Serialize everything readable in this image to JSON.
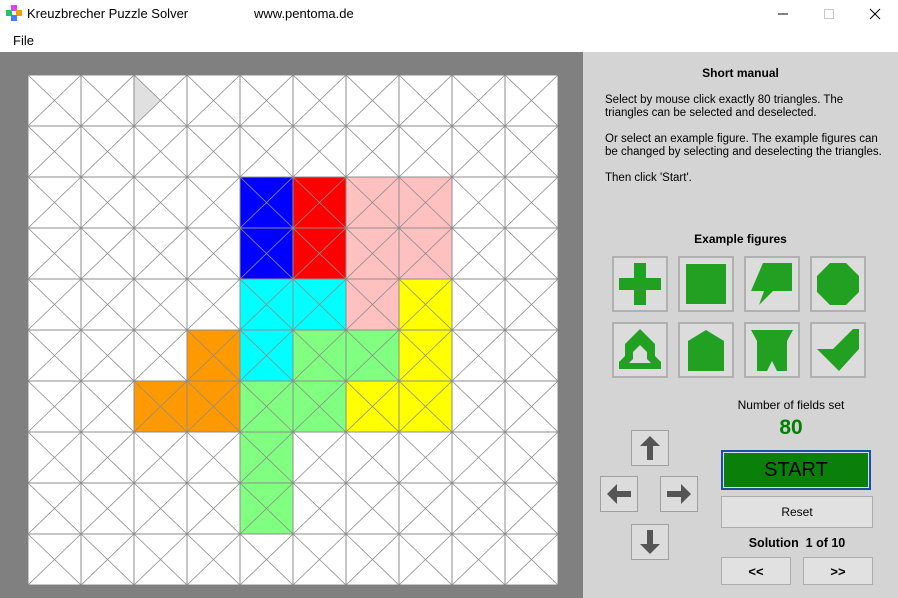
{
  "window": {
    "title": "Kreuzbrecher Puzzle Solver",
    "url": "www.pentoma.de",
    "controls": [
      "minimize",
      "maximize",
      "close"
    ]
  },
  "menu": {
    "items": [
      "File"
    ]
  },
  "manual": {
    "title": "Short manual",
    "paragraphs": [
      "Select by mouse click exactly 80 triangles. The triangles can be selected and deselected.",
      "Or select an example figure. The example figures can be changed by selecting and deselecting the triangles.",
      "Then click 'Start'."
    ]
  },
  "examples": {
    "title": "Example figures",
    "items": [
      "plus-figure",
      "square-figure",
      "arrow-figure",
      "octagon-figure",
      "arch-figure",
      "house-figure",
      "pillar-figure",
      "check-figure"
    ]
  },
  "fields": {
    "label": "Number of fields set",
    "value": "80"
  },
  "buttons": {
    "start": "START",
    "reset": "Reset",
    "prev": "<<",
    "next": ">>",
    "arrows": [
      "arrow-up-icon",
      "arrow-left-icon",
      "arrow-right-icon",
      "arrow-down-icon"
    ]
  },
  "solution": {
    "text": "Solution  1 of 10"
  },
  "board": {
    "cols": 10,
    "rows": 10,
    "highlight_cell": [
      2,
      0
    ],
    "pieces": [
      {
        "name": "blue",
        "color": "#0000ff",
        "cells": [
          [
            4,
            2
          ],
          [
            4,
            3
          ]
        ]
      },
      {
        "name": "red",
        "color": "#ff0000",
        "cells": [
          [
            5,
            2
          ],
          [
            5,
            3
          ]
        ]
      },
      {
        "name": "pink",
        "color": "#ffc0c0",
        "cells": [
          [
            6,
            2
          ],
          [
            7,
            2
          ],
          [
            6,
            3
          ],
          [
            7,
            3
          ],
          [
            6,
            4
          ]
        ]
      },
      {
        "name": "cyan",
        "color": "#00ffff",
        "cells": [
          [
            4,
            4
          ],
          [
            5,
            4
          ],
          [
            4,
            5
          ]
        ]
      },
      {
        "name": "orange",
        "color": "#ff9900",
        "cells": [
          [
            3,
            5
          ],
          [
            3,
            6
          ],
          [
            2,
            6
          ]
        ]
      },
      {
        "name": "green",
        "color": "#80ff80",
        "cells": [
          [
            5,
            5
          ],
          [
            6,
            5
          ],
          [
            4,
            6
          ],
          [
            5,
            6
          ],
          [
            4,
            7
          ],
          [
            4,
            8
          ]
        ]
      },
      {
        "name": "yellow",
        "color": "#ffff00",
        "cells": [
          [
            7,
            4
          ],
          [
            7,
            5
          ],
          [
            7,
            6
          ],
          [
            6,
            6
          ]
        ]
      }
    ]
  },
  "colors": {
    "accent_green": "#008000",
    "figure_green": "#20a020",
    "board_line": "#8c8c8c",
    "background_gray": "#808080"
  }
}
